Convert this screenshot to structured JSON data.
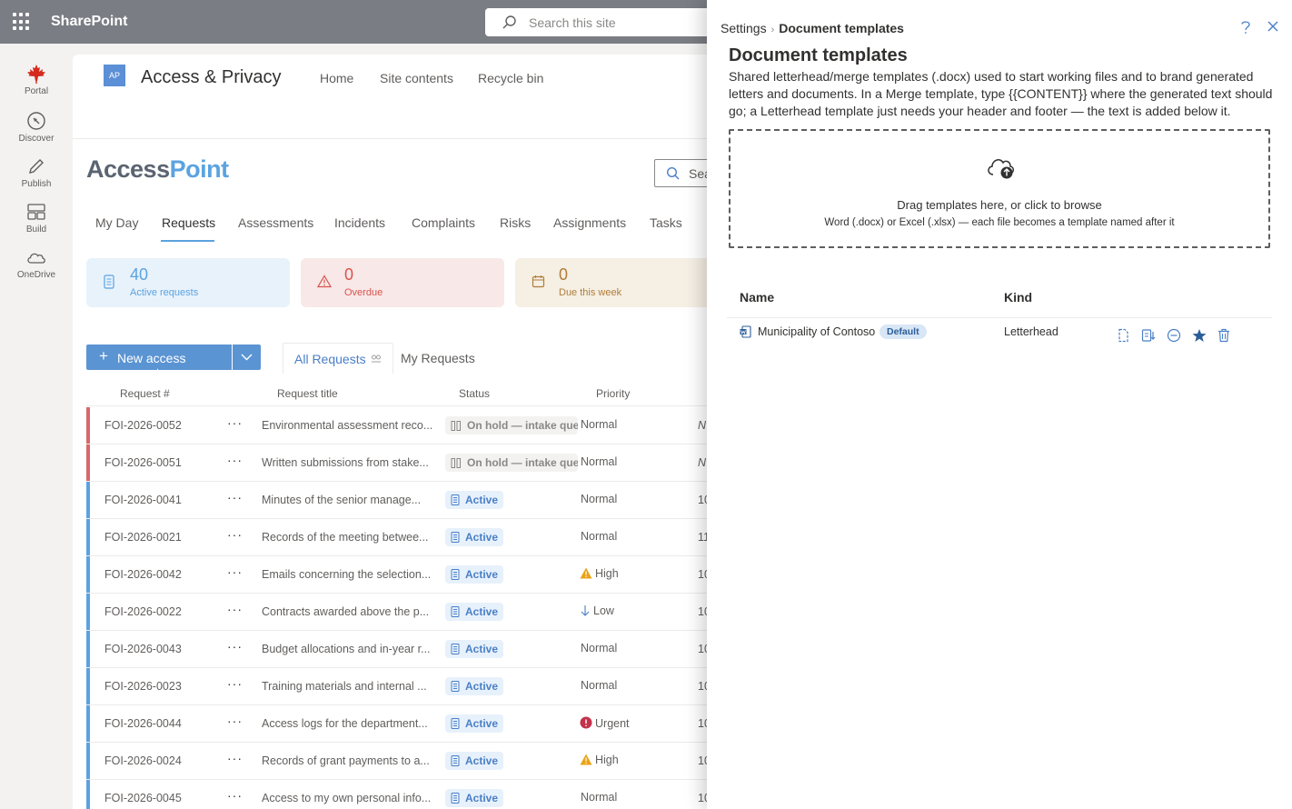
{
  "suite": {
    "brand": "SharePoint",
    "search_placeholder": "Search this site"
  },
  "appbar": {
    "items": [
      "Portal",
      "Discover",
      "Publish",
      "Build",
      "OneDrive"
    ]
  },
  "site": {
    "logo_initials": "AP",
    "title": "Access & Privacy",
    "nav": [
      "Home",
      "Site contents",
      "Recycle bin"
    ]
  },
  "app": {
    "logo_part1": "Access",
    "logo_part2": "Point",
    "search_placeholder": "Sea",
    "tabs": [
      "My Day",
      "Requests",
      "Assessments",
      "Incidents",
      "Complaints",
      "Risks",
      "Assignments",
      "Tasks"
    ],
    "active_tab": "Requests",
    "stats": [
      {
        "value": "40",
        "label": "Active requests",
        "color": "#5ba3e0",
        "bg": "#e8f2fb"
      },
      {
        "value": "0",
        "label": "Overdue",
        "color": "#d9534f",
        "bg": "#f8e8e7"
      },
      {
        "value": "0",
        "label": "Due this week",
        "color": "#b07d3a",
        "bg": "#f5efe4"
      }
    ],
    "new_button": "New access request",
    "views": [
      "All Requests",
      "My Requests"
    ],
    "columns": [
      "Request #",
      "Request title",
      "Status",
      "Priority"
    ],
    "rows": [
      {
        "num": "FOI-2026-0052",
        "title": "Environmental assessment reco...",
        "status": "On hold — intake queue",
        "status_kind": "hold",
        "priority": "Normal",
        "prio_kind": "none",
        "bar": "#d9686a",
        "cut": "N"
      },
      {
        "num": "FOI-2026-0051",
        "title": "Written submissions from stake...",
        "status": "On hold — intake queue",
        "status_kind": "hold",
        "priority": "Normal",
        "prio_kind": "none",
        "bar": "#d9686a",
        "cut": "N"
      },
      {
        "num": "FOI-2026-0041",
        "title": "Minutes of the senior manage...",
        "status": "Active",
        "status_kind": "active",
        "priority": "Normal",
        "prio_kind": "none",
        "bar": "#5ba3e0",
        "cut": "10"
      },
      {
        "num": "FOI-2026-0021",
        "title": "Records of the meeting betwee...",
        "status": "Active",
        "status_kind": "active",
        "priority": "Normal",
        "prio_kind": "none",
        "bar": "#5ba3e0",
        "cut": "11"
      },
      {
        "num": "FOI-2026-0042",
        "title": "Emails concerning the selection...",
        "status": "Active",
        "status_kind": "active",
        "priority": "High",
        "prio_kind": "high",
        "bar": "#5ba3e0",
        "cut": "10"
      },
      {
        "num": "FOI-2026-0022",
        "title": "Contracts awarded above the p...",
        "status": "Active",
        "status_kind": "active",
        "priority": "Low",
        "prio_kind": "low",
        "bar": "#5ba3e0",
        "cut": "10"
      },
      {
        "num": "FOI-2026-0043",
        "title": "Budget allocations and in-year r...",
        "status": "Active",
        "status_kind": "active",
        "priority": "Normal",
        "prio_kind": "none",
        "bar": "#5ba3e0",
        "cut": "10"
      },
      {
        "num": "FOI-2026-0023",
        "title": "Training materials and internal ...",
        "status": "Active",
        "status_kind": "active",
        "priority": "Normal",
        "prio_kind": "none",
        "bar": "#5ba3e0",
        "cut": "10"
      },
      {
        "num": "FOI-2026-0044",
        "title": "Access logs for the department...",
        "status": "Active",
        "status_kind": "active",
        "priority": "Urgent",
        "prio_kind": "urgent",
        "bar": "#5ba3e0",
        "cut": "10"
      },
      {
        "num": "FOI-2026-0024",
        "title": "Records of grant payments to a...",
        "status": "Active",
        "status_kind": "active",
        "priority": "High",
        "prio_kind": "high",
        "bar": "#5ba3e0",
        "cut": "10"
      },
      {
        "num": "FOI-2026-0045",
        "title": "Access to my own personal info...",
        "status": "Active",
        "status_kind": "active",
        "priority": "Normal",
        "prio_kind": "none",
        "bar": "#5ba3e0",
        "cut": "10"
      }
    ]
  },
  "panel": {
    "breadcrumb_root": "Settings",
    "breadcrumb_current": "Document templates",
    "title": "Document templates",
    "description": "Shared letterhead/merge templates (.docx) used to start working files and to brand generated letters and documents. In a Merge template, type {{CONTENT}} where the generated text should go; a Letterhead template just needs your header and footer — the text is added below it.",
    "drop_line1": "Drag templates here, or click to browse",
    "drop_line2": "Word (.docx) or Excel (.xlsx) — each file becomes a template named after it",
    "col_name": "Name",
    "col_kind": "Kind",
    "templates": [
      {
        "name": "Municipality of Contoso",
        "badge": "Default",
        "kind": "Letterhead"
      }
    ]
  }
}
